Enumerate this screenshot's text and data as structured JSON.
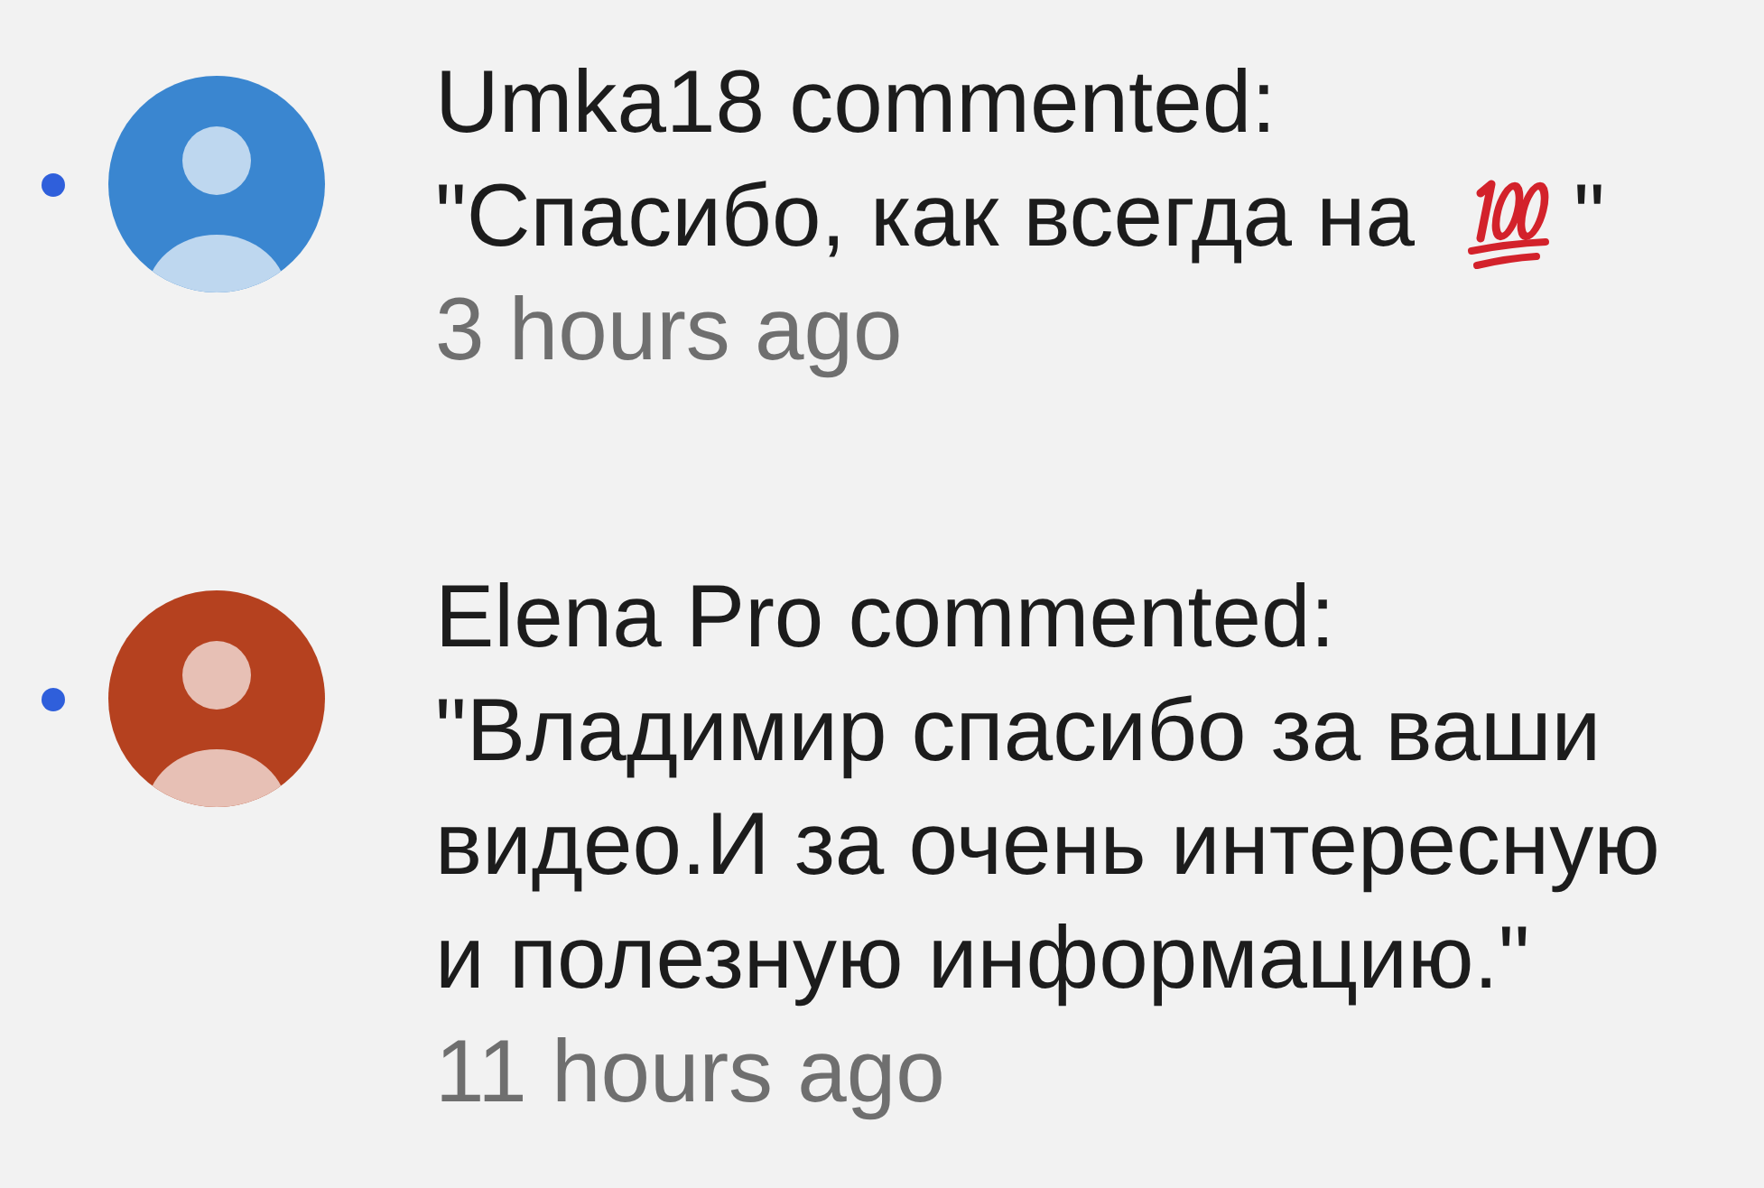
{
  "comments": [
    {
      "unread": true,
      "color": "#3a86d0",
      "author_line": "Umka18 commented:",
      "comment": [
        {
          "kind": "text",
          "text": "\"Спасибо, как всегда на"
        },
        {
          "kind": "emoji"
        },
        {
          "kind": "text",
          "text": "\""
        }
      ],
      "time": "3 hours ago"
    },
    {
      "unread": true,
      "color": "#b5411f",
      "author_line": "Elena Pro commented:",
      "comment": [
        {
          "kind": "text",
          "text": "\"Владимир спасибо за ваши видео.И за очень интересную и полезную информацию.\""
        }
      ],
      "time": "11 hours ago"
    }
  ]
}
